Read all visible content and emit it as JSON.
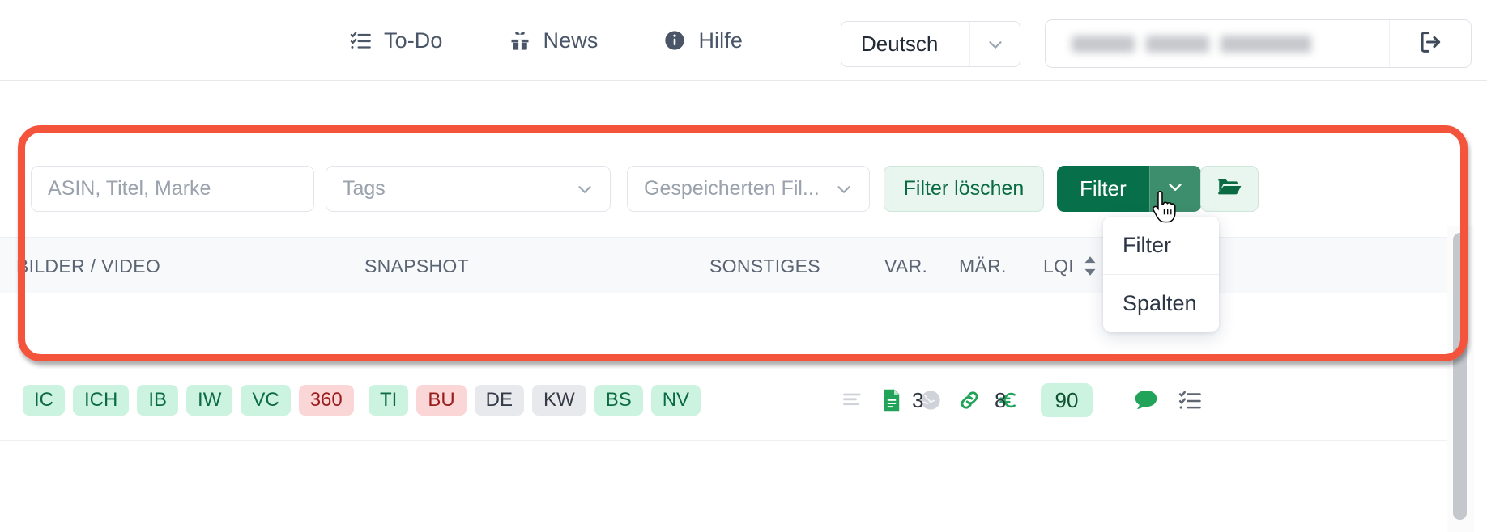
{
  "topnav": {
    "items": [
      {
        "label": "To-Do",
        "icon": "checklist-icon"
      },
      {
        "label": "News",
        "icon": "gift-icon"
      },
      {
        "label": "Hilfe",
        "icon": "info-icon"
      }
    ],
    "language": {
      "value": "Deutsch",
      "caret_icon": "chevron-down-icon"
    },
    "user": {
      "email_masked": "",
      "logout_icon": "logout-icon"
    }
  },
  "toolbar": {
    "search_placeholder": "ASIN, Titel, Marke",
    "search_value": "",
    "tags_placeholder": "Tags",
    "saved_filter_placeholder": "Gespeicherten Fil...",
    "clear_filter_label": "Filter löschen",
    "filter_label": "Filter",
    "filter_caret_icon": "chevron-down-icon",
    "folder_icon": "folder-open-icon"
  },
  "dropdown": {
    "items": [
      {
        "label": "Filter"
      },
      {
        "label": "Spalten"
      }
    ]
  },
  "table": {
    "headers": [
      {
        "label": "BILDER / VIDEO",
        "sortable": false
      },
      {
        "label": "SNAPSHOT",
        "sortable": false
      },
      {
        "label": "SONSTIGES",
        "sortable": false
      },
      {
        "label": "VAR.",
        "sortable": false
      },
      {
        "label": "MÄR.",
        "sortable": false
      },
      {
        "label": "LQI",
        "sortable": true
      }
    ],
    "row": {
      "bilder_video": [
        {
          "label": "IC",
          "tone": "green"
        },
        {
          "label": "ICH",
          "tone": "green"
        },
        {
          "label": "IB",
          "tone": "green"
        },
        {
          "label": "IW",
          "tone": "green"
        },
        {
          "label": "VC",
          "tone": "green"
        },
        {
          "label": "360",
          "tone": "red"
        }
      ],
      "snapshot": [
        {
          "label": "TI",
          "tone": "green"
        },
        {
          "label": "BU",
          "tone": "red"
        },
        {
          "label": "DE",
          "tone": "grey"
        },
        {
          "label": "KW",
          "tone": "grey"
        },
        {
          "label": "BS",
          "tone": "green"
        },
        {
          "label": "NV",
          "tone": "green"
        }
      ],
      "sonstiges_icons": [
        {
          "icon": "align-left-icon",
          "tone": "grey"
        },
        {
          "icon": "document-icon",
          "tone": "green"
        },
        {
          "icon": "globe-icon",
          "tone": "grey"
        },
        {
          "icon": "link-icon",
          "tone": "green"
        },
        {
          "icon": "euro-icon",
          "tone": "green"
        }
      ],
      "var": "3",
      "maer": "8",
      "lqi": "90",
      "actions": [
        {
          "icon": "comment-icon",
          "tone": "green"
        },
        {
          "icon": "checklist-icon",
          "tone": "grey"
        }
      ]
    }
  },
  "colors": {
    "accent_green": "#07704a",
    "accent_green_light": "#e9f5ef",
    "annotation_red": "#f4543c",
    "badge_green_bg": "#ccf3e0",
    "badge_red_bg": "#fbd6d6",
    "badge_grey_bg": "#e7e9ec"
  }
}
